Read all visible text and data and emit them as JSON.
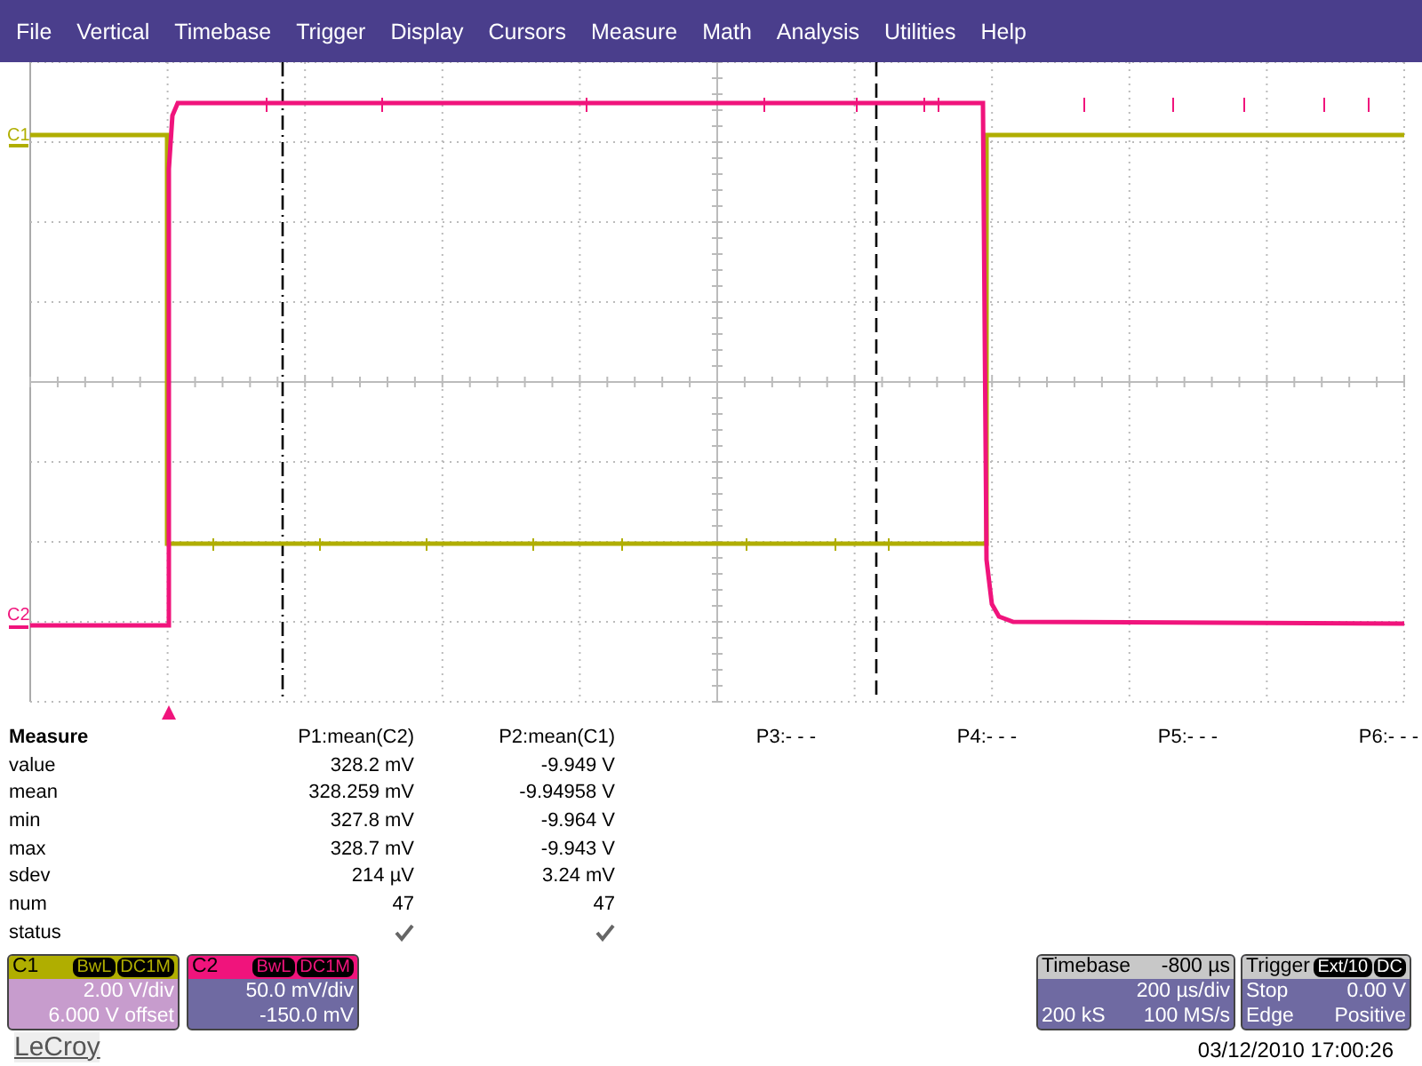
{
  "menu": [
    "File",
    "Vertical",
    "Timebase",
    "Trigger",
    "Display",
    "Cursors",
    "Measure",
    "Math",
    "Analysis",
    "Utilities",
    "Help"
  ],
  "traces": [
    {
      "label": "C1",
      "color": "#b0ae00"
    },
    {
      "label": "C2",
      "color": "#f0147c"
    }
  ],
  "measure": {
    "title": "Measure",
    "row_labels": [
      "value",
      "mean",
      "min",
      "max",
      "sdev",
      "num"
    ],
    "status_label": "status",
    "params": [
      {
        "header": "P1:mean(C2)",
        "values": [
          "328.2 mV",
          "328.259 mV",
          "327.8 mV",
          "328.7 mV",
          "214 µV",
          "47"
        ],
        "status_ok": true
      },
      {
        "header": "P2:mean(C1)",
        "values": [
          "-9.949 V",
          "-9.94958 V",
          "-9.964 V",
          "-9.943 V",
          "3.24 mV",
          "47"
        ],
        "status_ok": true
      },
      {
        "header": "P3:- - -"
      },
      {
        "header": "P4:- - -"
      },
      {
        "header": "P5:- - -"
      },
      {
        "header": "P6:- - -"
      }
    ]
  },
  "channels": [
    {
      "name": "C1",
      "color": "#b0ae00",
      "selected": true,
      "tags": [
        "BwL",
        "DC1M"
      ],
      "lines": [
        "2.00 V/div",
        "6.000 V offset"
      ]
    },
    {
      "name": "C2",
      "color": "#f0147c",
      "selected": false,
      "tags": [
        "BwL",
        "DC1M"
      ],
      "lines": [
        "50.0 mV/div",
        "-150.0 mV"
      ]
    }
  ],
  "timebase": {
    "title": "Timebase",
    "delay": "-800 µs",
    "scale": "200 µs/div",
    "samples": "200 kS",
    "rate": "100 MS/s"
  },
  "trigger": {
    "title": "Trigger",
    "tags": [
      "Ext/10",
      "DC"
    ],
    "mode": "Stop",
    "level": "0.00 V",
    "type": "Edge",
    "slope": "Positive"
  },
  "brand": "LeCroy",
  "datetime": "03/12/2010 17:00:26"
}
